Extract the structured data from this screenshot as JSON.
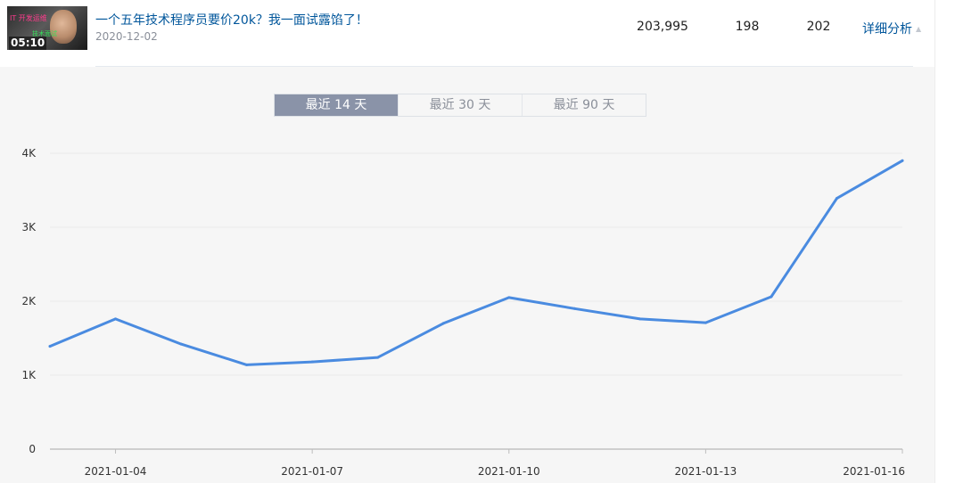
{
  "video": {
    "thumbnail_duration": "05:10",
    "thumbnail_caption_top": "IT 开发运维",
    "thumbnail_caption_bottom": "技术面试",
    "title": "一个五年技术程序员要价20k？我一面试露馅了！",
    "date": "2020-12-02",
    "views": "203,995",
    "stat_2": "198",
    "stat_3": "202",
    "detail_label": "详细分析"
  },
  "range_tabs": [
    {
      "label": "最近 14 天",
      "active": true
    },
    {
      "label": "最近 30 天",
      "active": false
    },
    {
      "label": "最近 90 天",
      "active": false
    }
  ],
  "colors": {
    "line": "#4a8be0",
    "link": "#00569b",
    "tab_active_bg": "#8a93a8"
  },
  "chart_data": {
    "type": "line",
    "x": [
      "2021-01-03",
      "2021-01-04",
      "2021-01-05",
      "2021-01-06",
      "2021-01-07",
      "2021-01-08",
      "2021-01-09",
      "2021-01-10",
      "2021-01-11",
      "2021-01-12",
      "2021-01-13",
      "2021-01-14",
      "2021-01-15",
      "2021-01-16"
    ],
    "x_tick_labels": [
      "2021-01-04",
      "2021-01-07",
      "2021-01-10",
      "2021-01-13",
      "2021-01-16"
    ],
    "series": [
      {
        "values": [
          1390,
          1760,
          1420,
          1140,
          1180,
          1240,
          1700,
          2050,
          1900,
          1760,
          1710,
          2060,
          3390,
          3900
        ]
      }
    ],
    "ylim": [
      0,
      4000
    ],
    "y_ticks": [
      0,
      1000,
      2000,
      3000,
      4000
    ],
    "y_tick_labels": [
      "0",
      "1K",
      "2K",
      "3K",
      "4K"
    ],
    "grid": true,
    "title": "",
    "xlabel": "",
    "ylabel": ""
  }
}
